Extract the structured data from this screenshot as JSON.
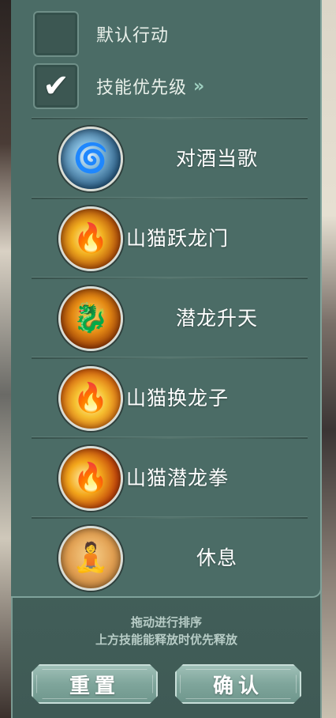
{
  "options": {
    "default_action": {
      "label": "默认行动",
      "checked": false
    },
    "skill_priority": {
      "label": "技能优先级",
      "checked": true,
      "chevron": "»"
    }
  },
  "skills": [
    {
      "name": "对酒当歌",
      "icon": "water-swirl-icon",
      "glyph": "🌀"
    },
    {
      "name": "山猫跃龙门",
      "icon": "flame-leap-icon",
      "glyph": "🔥"
    },
    {
      "name": "潜龙升天",
      "icon": "dragon-head-icon",
      "glyph": "🐉"
    },
    {
      "name": "山猫换龙子",
      "icon": "flame-monk-icon",
      "glyph": "🔥"
    },
    {
      "name": "山猫潜龙拳",
      "icon": "flame-fist-icon",
      "glyph": "🔥"
    },
    {
      "name": "休息",
      "icon": "meditation-icon",
      "glyph": "🧘"
    }
  ],
  "hint": {
    "line1": "拖动进行排序",
    "line2": "上方技能能释放时优先释放"
  },
  "buttons": {
    "reset": "重置",
    "confirm": "确认"
  },
  "colors": {
    "panel": "#496863",
    "accent": "#9fd0c0",
    "button": "#7fa59b"
  }
}
